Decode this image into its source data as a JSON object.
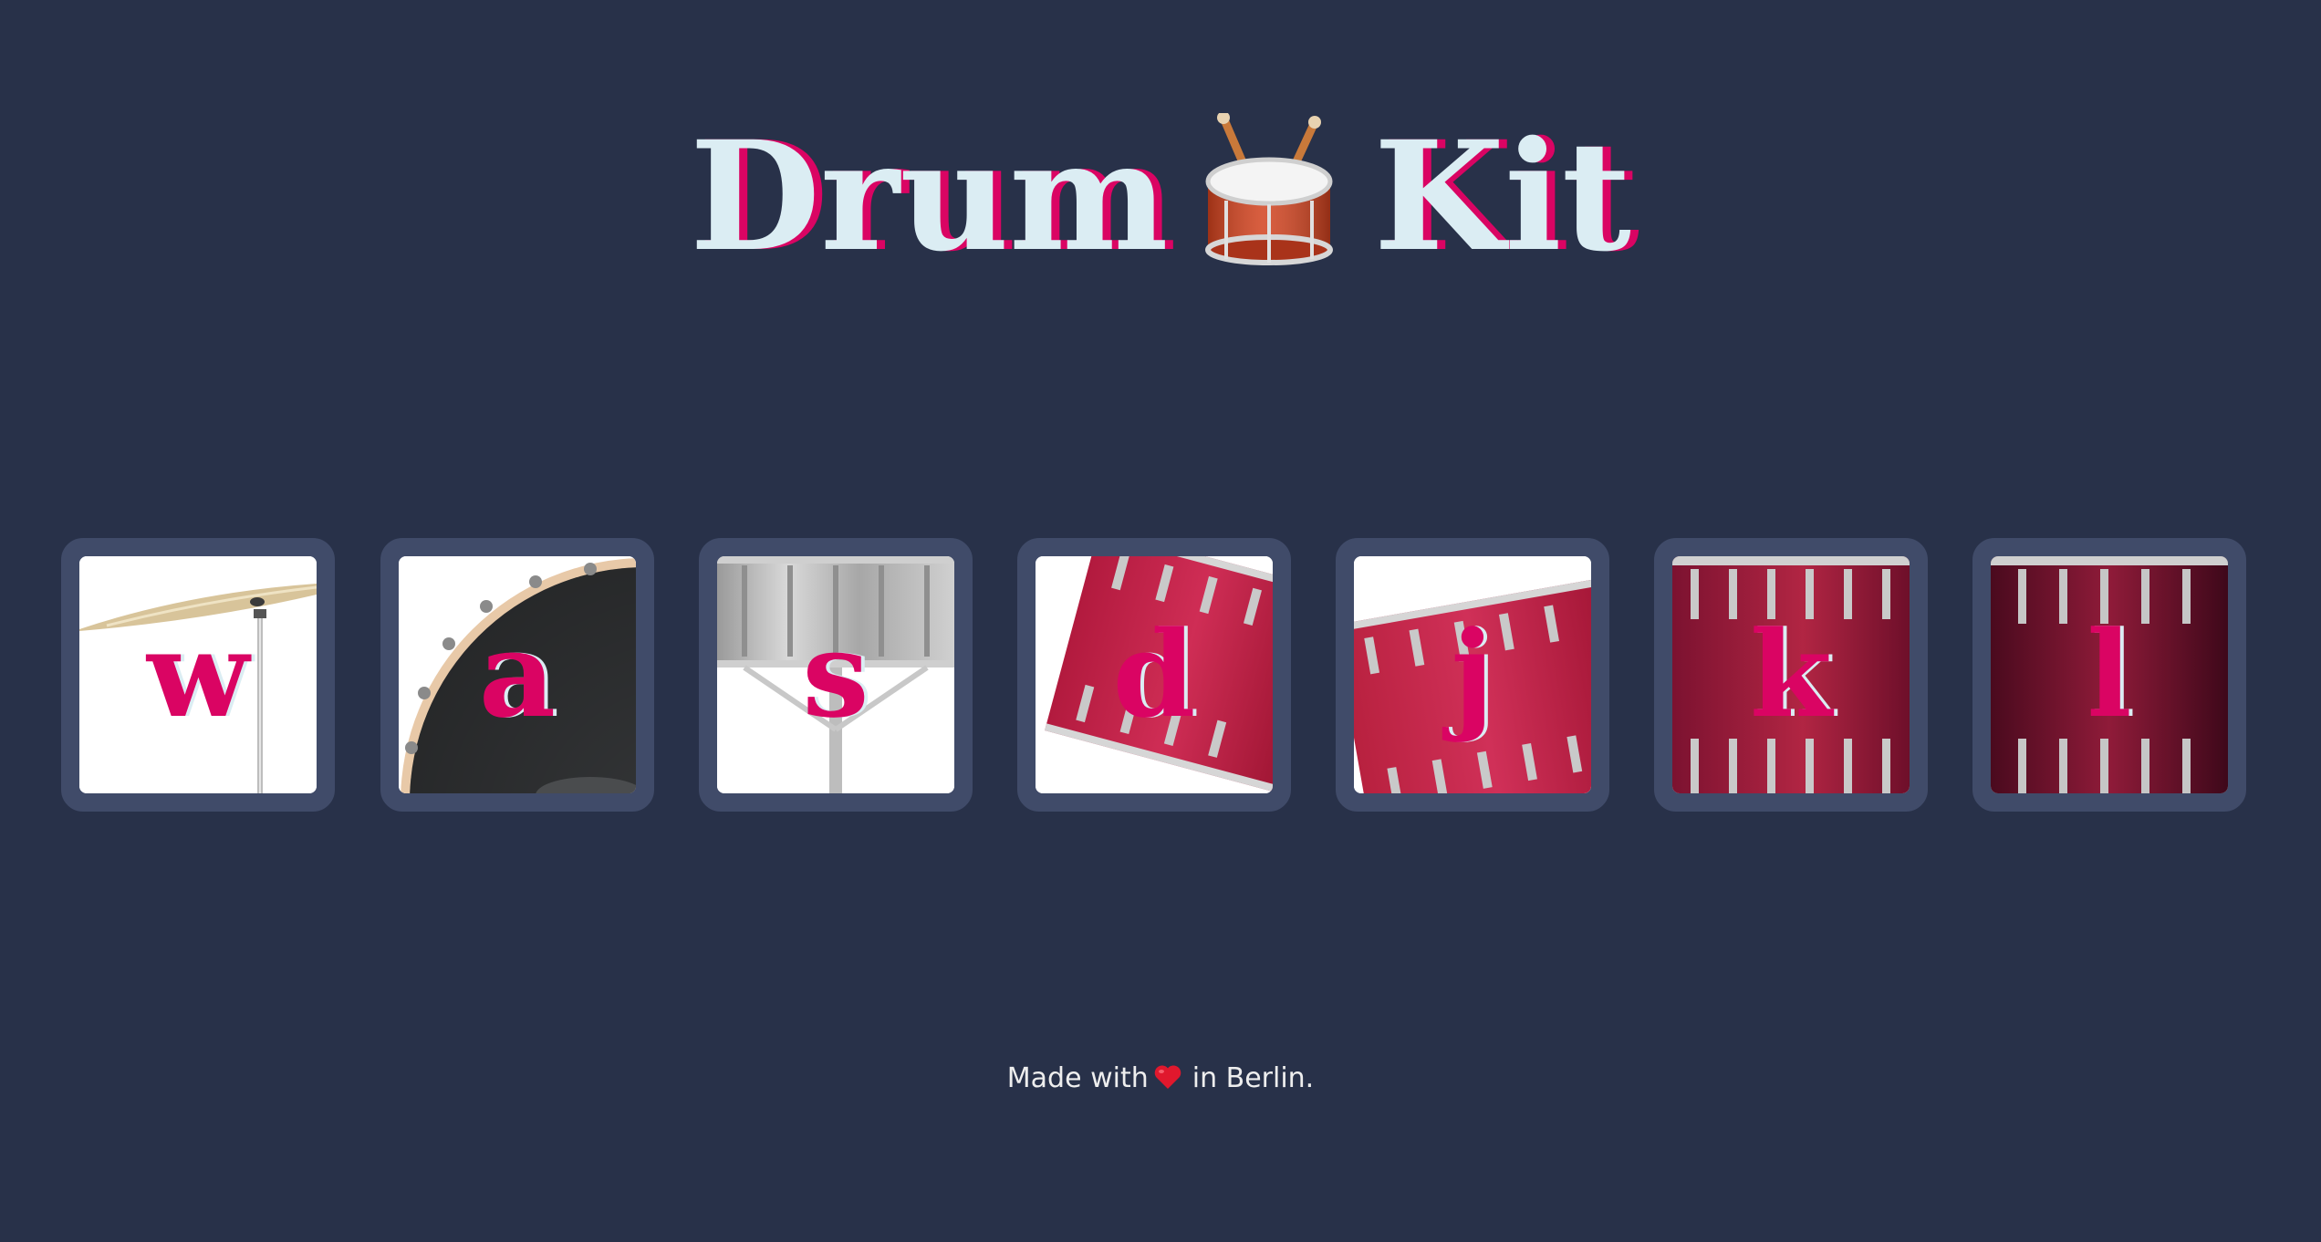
{
  "page": {
    "title_before": "Drum",
    "title_emoji": "drum-icon",
    "title_after": "Kit"
  },
  "drums": [
    {
      "key": "w",
      "instrument": "crash-cymbal-icon"
    },
    {
      "key": "a",
      "instrument": "kick-drum-icon"
    },
    {
      "key": "s",
      "instrument": "snare-drum-icon"
    },
    {
      "key": "d",
      "instrument": "tom-1-icon"
    },
    {
      "key": "j",
      "instrument": "tom-2-icon"
    },
    {
      "key": "k",
      "instrument": "tom-3-icon"
    },
    {
      "key": "l",
      "instrument": "tom-4-icon"
    }
  ],
  "footer": {
    "before": "Made with",
    "icon": "heart-icon",
    "after": "in Berlin."
  },
  "colors": {
    "background": "#283149",
    "tile_border": "#404B69",
    "accent": "#DA0463",
    "title_text": "#DBEDF3",
    "footer_text": "#EEEEEE"
  }
}
